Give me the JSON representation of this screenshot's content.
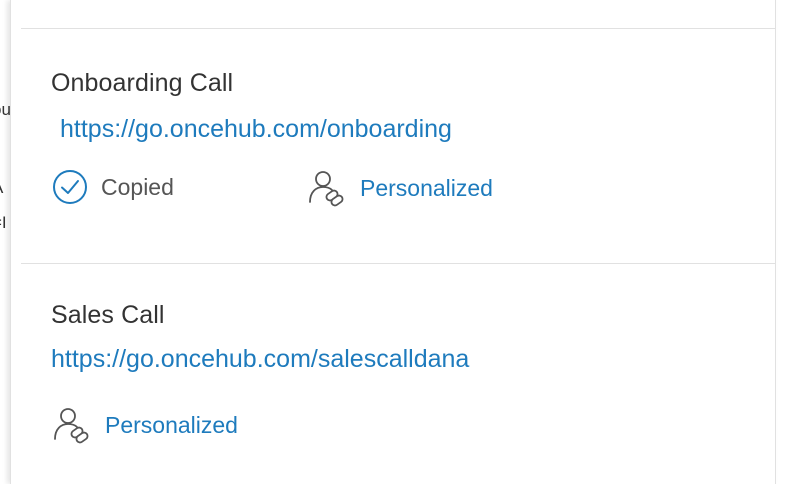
{
  "background_fragments": [
    "ou",
    "A",
    "=I"
  ],
  "cards": [
    {
      "title": "Onboarding Call",
      "url": "https://go.oncehub.com/onboarding",
      "copied_label": "Copied",
      "personalized_label": "Personalized"
    },
    {
      "title": "Sales Call",
      "url": "https://go.oncehub.com/salescalldana",
      "personalized_label": "Personalized"
    }
  ],
  "icons": {
    "copied": "check-circle-icon",
    "personalized": "person-link-icon"
  },
  "colors": {
    "link": "#1e7bbd",
    "text": "#333333",
    "divider": "#e1e1e1"
  }
}
